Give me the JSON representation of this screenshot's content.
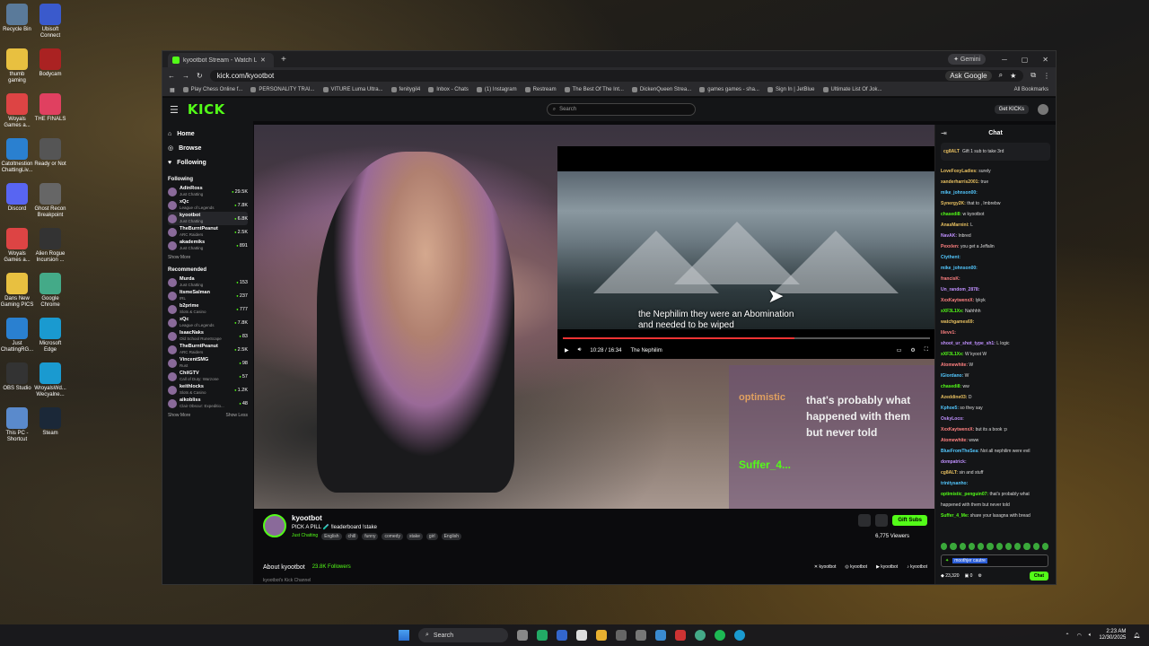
{
  "desktop": {
    "icons": [
      {
        "label": "Recycle Bin",
        "color": "#5a7a9a"
      },
      {
        "label": "Ubisoft Connect",
        "color": "#3a5acc"
      },
      {
        "label": "thumb gaming",
        "color": "#e8c040"
      },
      {
        "label": "Bodycam",
        "color": "#aa2222"
      },
      {
        "label": "Woyals Games a...",
        "color": "#d44"
      },
      {
        "label": "THE FINALS",
        "color": "#e04060"
      },
      {
        "label": "Catoltnestion ChattingLiv...",
        "color": "#2a80d0"
      },
      {
        "label": "Ready or Not",
        "color": "#555"
      },
      {
        "label": "Discord",
        "color": "#5865f2"
      },
      {
        "label": "Ghost Recon Breakpoint",
        "color": "#666"
      },
      {
        "label": "Woyals Games a...",
        "color": "#d44"
      },
      {
        "label": "Alien Rogue Incursion ...",
        "color": "#333"
      },
      {
        "label": "Dans New Gaming PICS",
        "color": "#e8c040"
      },
      {
        "label": "Google Chrome",
        "color": "#4a8"
      },
      {
        "label": "Just ChattingRG...",
        "color": "#2a80d0"
      },
      {
        "label": "Microsoft Edge",
        "color": "#1a9ad0"
      },
      {
        "label": "OBS Studio",
        "color": "#333"
      },
      {
        "label": "WroyalsWd... Wecyalne...",
        "color": "#1a9ad0"
      },
      {
        "label": "This PC - Shortcut",
        "color": "#5a8acc"
      },
      {
        "label": "Steam",
        "color": "#1b2838"
      }
    ]
  },
  "browser": {
    "tab_title": "kyootbot Stream - Watch Li...",
    "gemini": "Gemini",
    "url": "kick.com/kyootbot",
    "ask_google": "Ask Google",
    "bookmarks": [
      "Play Chess Online f...",
      "PERSONALITY TRAI...",
      "VITURE Luma Ultra...",
      "fenitygil4",
      "Inbox - Chats",
      "(1) Instagram",
      "Restream",
      "The Best Of The Int...",
      "DickenQueen Strea...",
      "games games - sha...",
      "Sign In | JetBlue",
      "Ultimate List Of Jok..."
    ],
    "all_bookmarks": "All Bookmarks"
  },
  "kick": {
    "logo": "KICK",
    "search_placeholder": "Search",
    "get_kicks": "Get KICKs",
    "nav": [
      {
        "label": "Home",
        "icon": "home-icon"
      },
      {
        "label": "Browse",
        "icon": "compass-icon"
      },
      {
        "label": "Following",
        "icon": "heart-icon"
      }
    ],
    "following_title": "Following",
    "following": [
      {
        "name": "AdinRoss",
        "game": "Just Chatting",
        "viewers": "29.5K"
      },
      {
        "name": "xQc",
        "game": "League of Legends",
        "viewers": "7.8K"
      },
      {
        "name": "kyootbot",
        "game": "Just Chatting",
        "viewers": "6.8K"
      },
      {
        "name": "TheBurntPeanut",
        "game": "ARC Raiders",
        "viewers": "2.5K"
      },
      {
        "name": "akademiks",
        "game": "Just Chatting",
        "viewers": "891"
      }
    ],
    "show_more": "Show More",
    "recommended_title": "Recommended",
    "recommended": [
      {
        "name": "Murda",
        "game": "Just Chatting",
        "viewers": "153"
      },
      {
        "name": "ItsmeSalman",
        "game": "IRL",
        "viewers": "237"
      },
      {
        "name": "b2prime",
        "game": "Slots & Casino",
        "viewers": "777"
      },
      {
        "name": "xQc",
        "game": "League of Legends",
        "viewers": "7.8K"
      },
      {
        "name": "IsaacNaks",
        "game": "Old School RuneScape",
        "viewers": "83"
      },
      {
        "name": "TheBurntPeanut",
        "game": "ARC Raiders",
        "viewers": "2.5K"
      },
      {
        "name": "VincentSMG",
        "game": "Rust",
        "viewers": "98"
      },
      {
        "name": "ChilGTV",
        "game": "Call of Duty: Warzone",
        "viewers": "57"
      },
      {
        "name": "keithlocks",
        "game": "Slots & Casino",
        "viewers": "1.2K"
      },
      {
        "name": "aikobliss",
        "game": "Clair Obscur: Expeditio...",
        "viewers": "48"
      }
    ],
    "show_less": "Show Less"
  },
  "video": {
    "pip_subtitle_1": "the Nephilim they were an Abomination",
    "pip_subtitle_2": "and needed to be wiped",
    "pip_time": "10:28 / 16:34",
    "pip_chapter": "The Nephilim",
    "pip_progress": 0.63,
    "overlay_user": "optimistic",
    "overlay_text": "that's probably what happened with them but never told",
    "overlay_green": "Suffer_4..."
  },
  "stream": {
    "name": "kyootbot",
    "title": "PICK A PILL 🧪 !leaderboard !stake",
    "category": "Just Chatting",
    "tags": [
      "English",
      "chill",
      "funny",
      "comedy",
      "stake",
      "girl",
      "English"
    ],
    "gift_subs": "Gift Subs",
    "viewers": "6,775 Viewers",
    "about": "About kyootbot",
    "followers": "23.8K Followers",
    "about_sub": "kyootbot's Kick Channel",
    "socials": [
      "kyootbot",
      "kyootbot",
      "kyootbot",
      "kyootbot"
    ]
  },
  "chat": {
    "title": "Chat",
    "pinned_user": "cg8ALT",
    "pinned_text": "Gift 1 sub to take 3rd",
    "messages": [
      {
        "user": "LoveFoxyLadies:",
        "text": "surely",
        "color": "#e8c060"
      },
      {
        "user": "xanderharris2001:",
        "text": "true",
        "color": "#e8c060"
      },
      {
        "user": "mike_johnson00:",
        "text": "",
        "color": "#53c8ff"
      },
      {
        "user": "Synergy2K:",
        "text": "that to , Imbrebw",
        "color": "#e8c060"
      },
      {
        "user": "chasedi8:",
        "text": "w kyootbot",
        "color": "#53fc18"
      },
      {
        "user": "AnasMarnini:",
        "text": "L",
        "color": "#e8c060"
      },
      {
        "user": "NavAK:",
        "text": "Inbred",
        "color": "#c090ff"
      },
      {
        "user": "Pexxlen:",
        "text": "you get a Jeffalin",
        "color": "#ff8080"
      },
      {
        "user": "Ctythent:",
        "text": "",
        "color": "#53c8ff"
      },
      {
        "user": "mike_johnson00:",
        "text": "",
        "color": "#53c8ff"
      },
      {
        "user": "francisK:",
        "text": "",
        "color": "#ff8080"
      },
      {
        "user": "Un_random_2878:",
        "text": "",
        "color": "#c090ff"
      },
      {
        "user": "XxxKaytwenxX:",
        "text": "lykyk",
        "color": "#ff8080"
      },
      {
        "user": "xXF3L1Xx:",
        "text": "Nahhhh",
        "color": "#53fc18"
      },
      {
        "user": "watchgames69:",
        "text": "",
        "color": "#e8c060"
      },
      {
        "user": "lilevv1:",
        "text": "",
        "color": "#ff8080"
      },
      {
        "user": "shoot_ur_shot_type_sh1:",
        "text": "L logic",
        "color": "#c090ff"
      },
      {
        "user": "xXF3L1Xx:",
        "text": "W kyoot W",
        "color": "#53fc18"
      },
      {
        "user": "Atomewhite:",
        "text": "W",
        "color": "#ff8080"
      },
      {
        "user": "IGiordano:",
        "text": "W",
        "color": "#53c8ff"
      },
      {
        "user": "chasedi8:",
        "text": "ww",
        "color": "#53fc18"
      },
      {
        "user": "Azeddine03:",
        "text": "D",
        "color": "#e8c060"
      },
      {
        "user": "Kphoe5:",
        "text": "so they say",
        "color": "#53c8ff"
      },
      {
        "user": "OskyLoco:",
        "text": "",
        "color": "#c090ff"
      },
      {
        "user": "XxxKaytwenxX:",
        "text": "but its a book :p",
        "color": "#ff8080"
      },
      {
        "user": "Atomewhite:",
        "text": "www",
        "color": "#ff8080"
      },
      {
        "user": "BlueFromTheSea:",
        "text": "Not all nephilim were evil",
        "color": "#53c8ff"
      },
      {
        "user": "dompatrick:",
        "text": "",
        "color": "#c090ff"
      },
      {
        "user": "cg8ALT:",
        "text": "sin and stuff",
        "color": "#e8c060"
      },
      {
        "user": "trinitysanho:",
        "text": "",
        "color": "#53c8ff"
      },
      {
        "user": "optimistic_penguin07:",
        "text": "that's probably what",
        "color": "#53fc18"
      },
      {
        "user": "",
        "text": "happened with them but never told",
        "color": "#ddd"
      },
      {
        "user": "Suffer_4_Me:",
        "text": "share your lasagna with bread",
        "color": "#53fc18"
      }
    ],
    "input_text": "moothjer cautre",
    "kick_count": "23,320",
    "zero_count": "0",
    "chat_button": "Chat"
  },
  "taskbar": {
    "search": "Search",
    "time": "2:23 AM",
    "date": "12/30/2025"
  }
}
